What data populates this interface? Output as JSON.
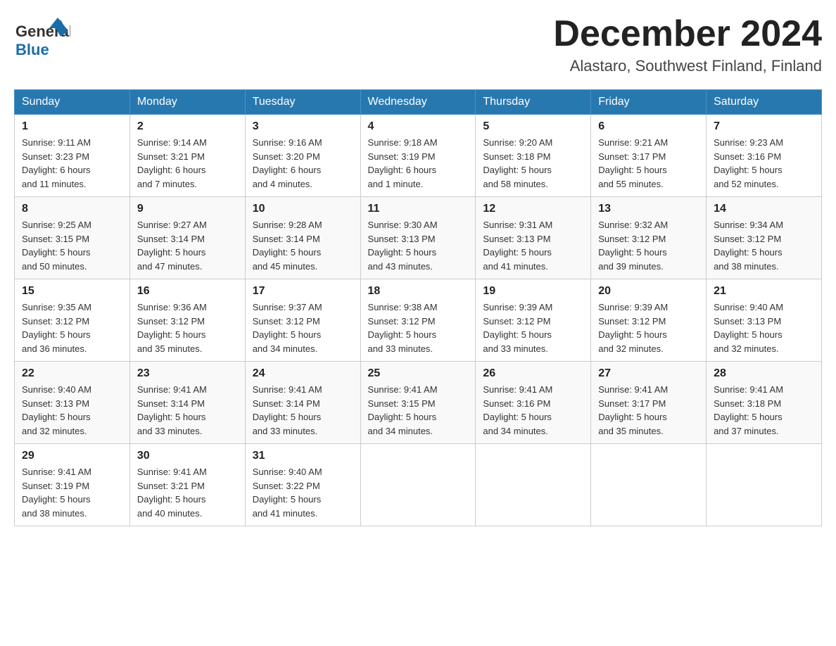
{
  "header": {
    "logo": {
      "general": "General",
      "blue": "Blue"
    },
    "title": "December 2024",
    "subtitle": "Alastaro, Southwest Finland, Finland"
  },
  "calendar": {
    "days_of_week": [
      "Sunday",
      "Monday",
      "Tuesday",
      "Wednesday",
      "Thursday",
      "Friday",
      "Saturday"
    ],
    "weeks": [
      [
        {
          "day": "1",
          "sunrise": "Sunrise: 9:11 AM",
          "sunset": "Sunset: 3:23 PM",
          "daylight": "Daylight: 6 hours",
          "daylight2": "and 11 minutes."
        },
        {
          "day": "2",
          "sunrise": "Sunrise: 9:14 AM",
          "sunset": "Sunset: 3:21 PM",
          "daylight": "Daylight: 6 hours",
          "daylight2": "and 7 minutes."
        },
        {
          "day": "3",
          "sunrise": "Sunrise: 9:16 AM",
          "sunset": "Sunset: 3:20 PM",
          "daylight": "Daylight: 6 hours",
          "daylight2": "and 4 minutes."
        },
        {
          "day": "4",
          "sunrise": "Sunrise: 9:18 AM",
          "sunset": "Sunset: 3:19 PM",
          "daylight": "Daylight: 6 hours",
          "daylight2": "and 1 minute."
        },
        {
          "day": "5",
          "sunrise": "Sunrise: 9:20 AM",
          "sunset": "Sunset: 3:18 PM",
          "daylight": "Daylight: 5 hours",
          "daylight2": "and 58 minutes."
        },
        {
          "day": "6",
          "sunrise": "Sunrise: 9:21 AM",
          "sunset": "Sunset: 3:17 PM",
          "daylight": "Daylight: 5 hours",
          "daylight2": "and 55 minutes."
        },
        {
          "day": "7",
          "sunrise": "Sunrise: 9:23 AM",
          "sunset": "Sunset: 3:16 PM",
          "daylight": "Daylight: 5 hours",
          "daylight2": "and 52 minutes."
        }
      ],
      [
        {
          "day": "8",
          "sunrise": "Sunrise: 9:25 AM",
          "sunset": "Sunset: 3:15 PM",
          "daylight": "Daylight: 5 hours",
          "daylight2": "and 50 minutes."
        },
        {
          "day": "9",
          "sunrise": "Sunrise: 9:27 AM",
          "sunset": "Sunset: 3:14 PM",
          "daylight": "Daylight: 5 hours",
          "daylight2": "and 47 minutes."
        },
        {
          "day": "10",
          "sunrise": "Sunrise: 9:28 AM",
          "sunset": "Sunset: 3:14 PM",
          "daylight": "Daylight: 5 hours",
          "daylight2": "and 45 minutes."
        },
        {
          "day": "11",
          "sunrise": "Sunrise: 9:30 AM",
          "sunset": "Sunset: 3:13 PM",
          "daylight": "Daylight: 5 hours",
          "daylight2": "and 43 minutes."
        },
        {
          "day": "12",
          "sunrise": "Sunrise: 9:31 AM",
          "sunset": "Sunset: 3:13 PM",
          "daylight": "Daylight: 5 hours",
          "daylight2": "and 41 minutes."
        },
        {
          "day": "13",
          "sunrise": "Sunrise: 9:32 AM",
          "sunset": "Sunset: 3:12 PM",
          "daylight": "Daylight: 5 hours",
          "daylight2": "and 39 minutes."
        },
        {
          "day": "14",
          "sunrise": "Sunrise: 9:34 AM",
          "sunset": "Sunset: 3:12 PM",
          "daylight": "Daylight: 5 hours",
          "daylight2": "and 38 minutes."
        }
      ],
      [
        {
          "day": "15",
          "sunrise": "Sunrise: 9:35 AM",
          "sunset": "Sunset: 3:12 PM",
          "daylight": "Daylight: 5 hours",
          "daylight2": "and 36 minutes."
        },
        {
          "day": "16",
          "sunrise": "Sunrise: 9:36 AM",
          "sunset": "Sunset: 3:12 PM",
          "daylight": "Daylight: 5 hours",
          "daylight2": "and 35 minutes."
        },
        {
          "day": "17",
          "sunrise": "Sunrise: 9:37 AM",
          "sunset": "Sunset: 3:12 PM",
          "daylight": "Daylight: 5 hours",
          "daylight2": "and 34 minutes."
        },
        {
          "day": "18",
          "sunrise": "Sunrise: 9:38 AM",
          "sunset": "Sunset: 3:12 PM",
          "daylight": "Daylight: 5 hours",
          "daylight2": "and 33 minutes."
        },
        {
          "day": "19",
          "sunrise": "Sunrise: 9:39 AM",
          "sunset": "Sunset: 3:12 PM",
          "daylight": "Daylight: 5 hours",
          "daylight2": "and 33 minutes."
        },
        {
          "day": "20",
          "sunrise": "Sunrise: 9:39 AM",
          "sunset": "Sunset: 3:12 PM",
          "daylight": "Daylight: 5 hours",
          "daylight2": "and 32 minutes."
        },
        {
          "day": "21",
          "sunrise": "Sunrise: 9:40 AM",
          "sunset": "Sunset: 3:13 PM",
          "daylight": "Daylight: 5 hours",
          "daylight2": "and 32 minutes."
        }
      ],
      [
        {
          "day": "22",
          "sunrise": "Sunrise: 9:40 AM",
          "sunset": "Sunset: 3:13 PM",
          "daylight": "Daylight: 5 hours",
          "daylight2": "and 32 minutes."
        },
        {
          "day": "23",
          "sunrise": "Sunrise: 9:41 AM",
          "sunset": "Sunset: 3:14 PM",
          "daylight": "Daylight: 5 hours",
          "daylight2": "and 33 minutes."
        },
        {
          "day": "24",
          "sunrise": "Sunrise: 9:41 AM",
          "sunset": "Sunset: 3:14 PM",
          "daylight": "Daylight: 5 hours",
          "daylight2": "and 33 minutes."
        },
        {
          "day": "25",
          "sunrise": "Sunrise: 9:41 AM",
          "sunset": "Sunset: 3:15 PM",
          "daylight": "Daylight: 5 hours",
          "daylight2": "and 34 minutes."
        },
        {
          "day": "26",
          "sunrise": "Sunrise: 9:41 AM",
          "sunset": "Sunset: 3:16 PM",
          "daylight": "Daylight: 5 hours",
          "daylight2": "and 34 minutes."
        },
        {
          "day": "27",
          "sunrise": "Sunrise: 9:41 AM",
          "sunset": "Sunset: 3:17 PM",
          "daylight": "Daylight: 5 hours",
          "daylight2": "and 35 minutes."
        },
        {
          "day": "28",
          "sunrise": "Sunrise: 9:41 AM",
          "sunset": "Sunset: 3:18 PM",
          "daylight": "Daylight: 5 hours",
          "daylight2": "and 37 minutes."
        }
      ],
      [
        {
          "day": "29",
          "sunrise": "Sunrise: 9:41 AM",
          "sunset": "Sunset: 3:19 PM",
          "daylight": "Daylight: 5 hours",
          "daylight2": "and 38 minutes."
        },
        {
          "day": "30",
          "sunrise": "Sunrise: 9:41 AM",
          "sunset": "Sunset: 3:21 PM",
          "daylight": "Daylight: 5 hours",
          "daylight2": "and 40 minutes."
        },
        {
          "day": "31",
          "sunrise": "Sunrise: 9:40 AM",
          "sunset": "Sunset: 3:22 PM",
          "daylight": "Daylight: 5 hours",
          "daylight2": "and 41 minutes."
        },
        null,
        null,
        null,
        null
      ]
    ]
  }
}
